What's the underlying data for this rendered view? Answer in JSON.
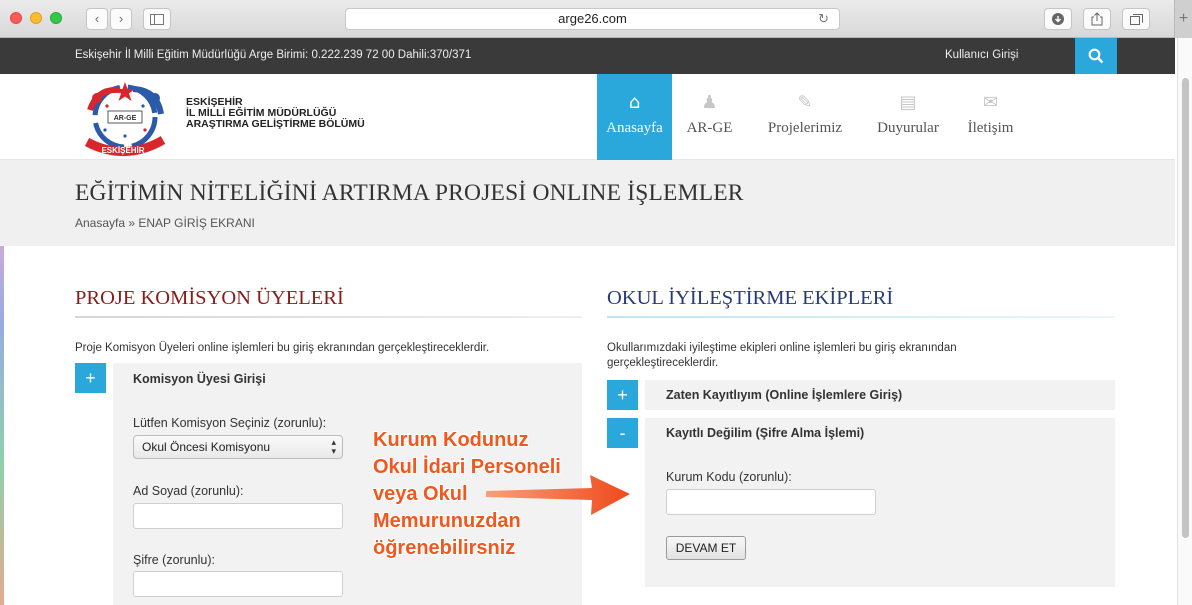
{
  "browser": {
    "url": "arge26.com",
    "back_glyph": "‹",
    "forward_glyph": "›",
    "reload_glyph": "↻",
    "newtab_glyph": "+"
  },
  "topbar": {
    "info": "Eskişehir İl Milli Eğitim Müdürlüğü Arge Birimi: 0.222.239 72 00 Dahili:370/371",
    "login": "Kullanıcı Girişi",
    "search_icon": "search-icon"
  },
  "header": {
    "org_line1": "ESKİŞEHİR",
    "org_line2": "İL MİLLİ EĞİTİM MÜDÜRLÜĞÜ",
    "org_line3": "ARAŞTIRMA GELİŞTİRME BÖLÜMÜ",
    "logo_text": "AR-GE",
    "logo_bottom": "ESKİŞEHİR",
    "nav": [
      {
        "label": "Anasayfa",
        "icon": "home-icon",
        "glyph": "⌂",
        "active": true
      },
      {
        "label": "AR-GE",
        "icon": "users-icon",
        "glyph": "♟",
        "active": false
      },
      {
        "label": "Projelerimiz",
        "icon": "pencil-icon",
        "glyph": "✎",
        "active": false
      },
      {
        "label": "Duyurular",
        "icon": "document-icon",
        "glyph": "▤",
        "active": false
      },
      {
        "label": "İletişim",
        "icon": "envelope-icon",
        "glyph": "✉",
        "active": false
      }
    ]
  },
  "page": {
    "title": "EĞİTİMİN NİTELİĞİNİ ARTIRMA PROJESİ ONLINE İŞLEMLER",
    "breadcrumb": "Anasayfa » ENAP GİRİŞ EKRANI"
  },
  "left": {
    "heading": "PROJE KOMİSYON ÜYELERİ",
    "desc": "Proje Komisyon Üyeleri online işlemleri bu giriş ekranından gerçekleştireceklerdir.",
    "panel_title": "Komisyon Üyesi Girişi",
    "panel_toggle": "+",
    "select_label": "Lütfen Komisyon Seçiniz (zorunlu):",
    "select_value": "Okul Öncesi Komisyonu",
    "name_label": "Ad Soyad (zorunlu):",
    "name_value": "",
    "password_label": "Şifre (zorunlu):",
    "password_value": ""
  },
  "right": {
    "heading": "OKUL İYİLEŞTİRME EKİPLERİ",
    "desc_line1": "Okullarımızdaki iyileştime ekipleri online işlemleri bu giriş ekranından",
    "desc_line2": "gerçekleştireceklerdir.",
    "panel1_title": "Zaten Kayıtlıyım (Online İşlemlere Giriş)",
    "panel1_toggle": "+",
    "panel2_title": "Kayıtlı Değilim (Şifre Alma İşlemi)",
    "panel2_toggle": "-",
    "code_label": "Kurum Kodu (zorunlu):",
    "code_value": "",
    "submit": "DEVAM ET"
  },
  "annotation": {
    "line1": "Kurum Kodunuz",
    "line2": "Okul İdari Personeli",
    "line3": "veya Okul",
    "line4": "Memurunuzdan",
    "line5": "öğrenebilirsniz",
    "color": "#f0581e"
  },
  "colors": {
    "accent": "#2aa8dc",
    "left_heading": "#8b1a1a",
    "right_heading": "#2a3a78",
    "topbar": "#3a3a3a"
  }
}
